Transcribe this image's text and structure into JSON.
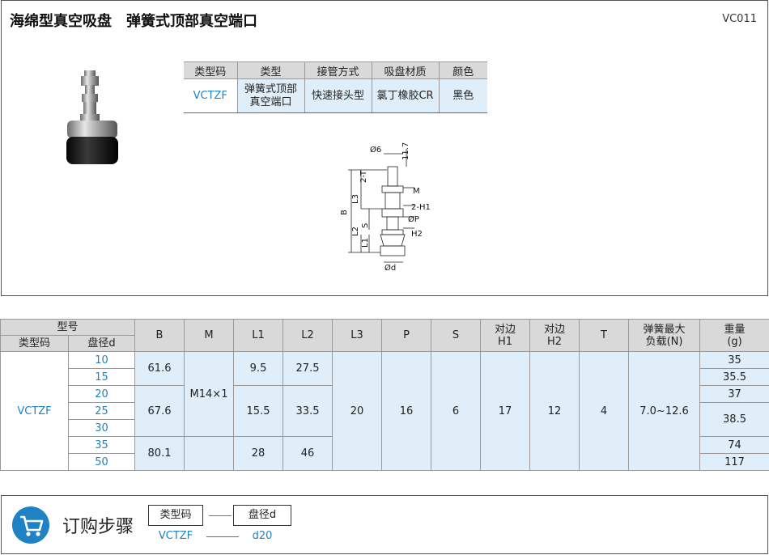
{
  "header": {
    "title": "海绵型真空吸盘　弹簧式顶部真空端口",
    "code": "VC011"
  },
  "spec_table": {
    "headers": [
      "类型码",
      "类型",
      "接管方式",
      "吸盘材质",
      "颜色"
    ],
    "row": [
      "VCTZF",
      "弹簧式顶部\n真空端口",
      "快速接头型",
      "氯丁橡胶CR",
      "黑色"
    ]
  },
  "drawing": {
    "labels": {
      "d6": "Ø6",
      "h117": "11.7",
      "two_t": "2-T",
      "m": "M",
      "l3": "L3",
      "two_h1": "2-H1",
      "b": "B",
      "s": "S",
      "p": "ØP",
      "l2": "L2",
      "h2": "H2",
      "l1": "L1",
      "d": "Ød"
    }
  },
  "main_table": {
    "group_header": "型号",
    "sub_headers": [
      "类型码",
      "盘径d"
    ],
    "headers": {
      "b": "B",
      "m": "M",
      "l1": "L1",
      "l2": "L2",
      "l3": "L3",
      "p": "P",
      "s": "S",
      "h1": "对边\nH1",
      "h2": "对边\nH2",
      "t": "T",
      "spring": "弹簧最大\n负载(N)",
      "weight": "重量\n(g)"
    },
    "type_code": "VCTZF",
    "diameters": [
      "10",
      "15",
      "20",
      "25",
      "30",
      "35",
      "50"
    ],
    "b_values": [
      "61.6",
      "67.6",
      "80.1"
    ],
    "m_value": "M14×1",
    "l1_values": [
      "9.5",
      "15.5",
      "28"
    ],
    "l2_values": [
      "27.5",
      "33.5",
      "46"
    ],
    "l3_value": "20",
    "p_value": "16",
    "s_value": "6",
    "h1_value": "17",
    "h2_value": "12",
    "t_value": "4",
    "spring_value": "7.0~12.6",
    "weights": [
      "35",
      "35.5",
      "37",
      "38.5",
      "74",
      "117"
    ]
  },
  "order": {
    "title": "订购步骤",
    "box1": "类型码",
    "box2": "盘径d",
    "val1": "VCTZF",
    "val2": "d20"
  },
  "colors": {
    "accent_blue": "#1e82c4",
    "cell_blue": "#dfeef8",
    "header_gray": "#d9d9d9"
  }
}
